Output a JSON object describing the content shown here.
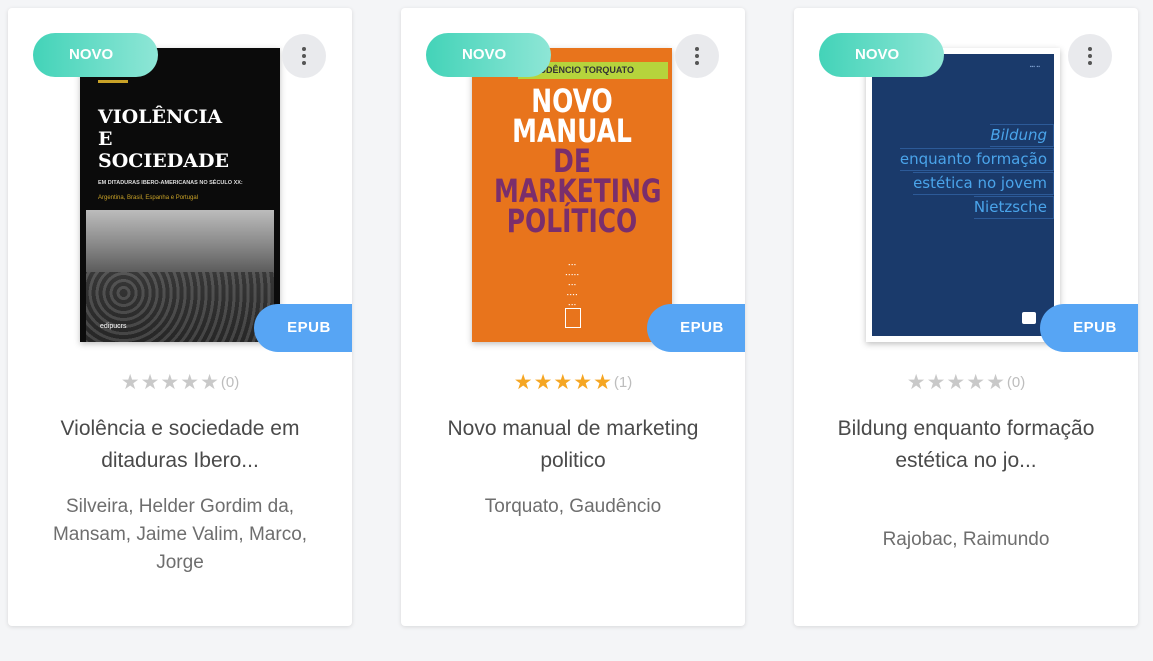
{
  "books": [
    {
      "badge": "NOVO",
      "format": "EPUB",
      "title": "Violência e sociedade em ditaduras Ibero...",
      "author": "Silveira, Helder Gordim da, Mansam, Jaime Valim, Marco, Jorge",
      "rating_count": "(0)",
      "rating_stars": 0,
      "cover": {
        "title_line1": "VIOLÊNCIA",
        "title_line2": "E",
        "title_line3": "SOCIEDADE",
        "subtitle": "EM DITADURAS IBERO-AMERICANAS NO SÉCULO XX:",
        "subtitle2": "Argentina, Brasil, Espanha e Portugal",
        "publisher": "edipucrs"
      }
    },
    {
      "badge": "NOVO",
      "format": "EPUB",
      "title": "Novo manual de marketing politico",
      "author": "Torquato, Gaudêncio",
      "rating_count": "(1)",
      "rating_stars": 5,
      "cover": {
        "author": "GAUDÊNCIO TORQUATO",
        "title_line1": "NOVO",
        "title_line2": "MANUAL",
        "title_line3": "DE",
        "title_line4": "MARKETING",
        "title_line5": "POLÍTICO"
      }
    },
    {
      "badge": "NOVO",
      "format": "EPUB",
      "title": "Bildung enquanto formação estética no jo...",
      "author": "Rajobac, Raimundo",
      "rating_count": "(0)",
      "rating_stars": 0,
      "cover": {
        "line1": "Bildung",
        "line2": "enquanto formação",
        "line3": "estética no jovem",
        "line4": "Nietzsche"
      }
    }
  ],
  "colors": {
    "new_badge": "#43d3b8",
    "epub_badge": "#57a5f4",
    "star_on": "#f5a623",
    "star_off": "#c9c9c9"
  }
}
